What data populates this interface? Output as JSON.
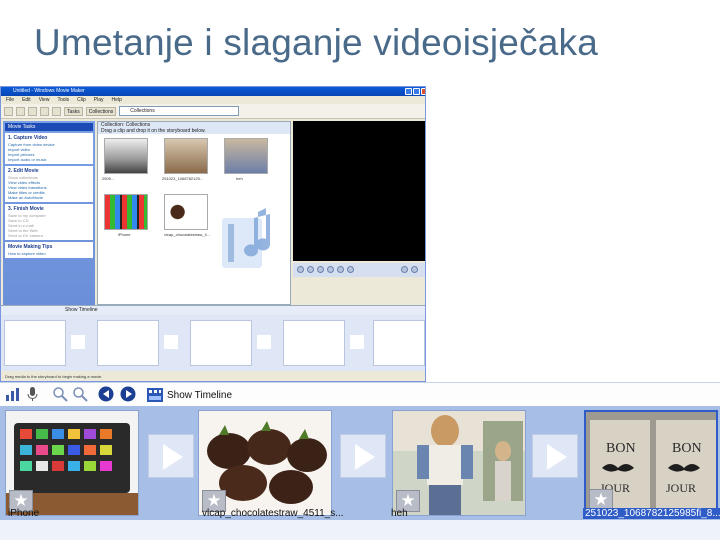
{
  "slide": {
    "title": "Umetanje i slaganje videoisječaka"
  },
  "wmm": {
    "window_title": "Untitled - Windows Movie Maker",
    "menu": [
      "File",
      "Edit",
      "View",
      "Tools",
      "Clip",
      "Play",
      "Help"
    ],
    "toolbar": {
      "tasks_label": "Tasks",
      "collections_label": "Collections",
      "combo_value": "Collections"
    },
    "tasks": {
      "header": "Movie Tasks",
      "sections": [
        {
          "title": "1. Capture Video",
          "items": [
            "Capture from video device",
            "Import video",
            "Import pictures",
            "Import audio or music"
          ]
        },
        {
          "title": "2. Edit Movie",
          "items": [
            "Show collections",
            "View video effects",
            "View video transitions",
            "Make titles or credits",
            "Make an AutoMovie"
          ]
        },
        {
          "title": "3. Finish Movie",
          "items": [
            "Save to my computer",
            "Save to CD",
            "Send in e-mail",
            "Send to the Web",
            "Send to DV camera"
          ]
        },
        {
          "title": "Movie Making Tips",
          "items": [
            "How to capture video"
          ]
        }
      ]
    },
    "collection": {
      "title": "Collection: Collections",
      "hint": "Drag a clip and drop it on the storyboard below.",
      "clip_labels": [
        "2509...",
        "251023_1068782125...",
        "heh",
        "iPhone",
        "vlcap_chocolatestraw_4..."
      ]
    },
    "storyboard_bar_label": "Show Timeline",
    "status": "Drag media to the storyboard to begin making a movie."
  },
  "storyboard": {
    "show_timeline_label": "Show Timeline",
    "clips": [
      {
        "caption": "iPhone",
        "selected": false
      },
      {
        "caption": "vlcap_chocolatestraw_4511_s...",
        "selected": false
      },
      {
        "caption": "heh",
        "selected": false
      },
      {
        "caption": "251023_1068782125985fi_8...",
        "selected": true
      }
    ]
  },
  "colors": {
    "title": "#4a6a8a",
    "storyboard_bg": "#a7bfe6",
    "selection": "#2f5cc7"
  },
  "icons": [
    "play-icon",
    "rewind-icon",
    "zoom-in-icon",
    "zoom-out-icon",
    "microphone-icon",
    "star-icon",
    "film-icon"
  ]
}
